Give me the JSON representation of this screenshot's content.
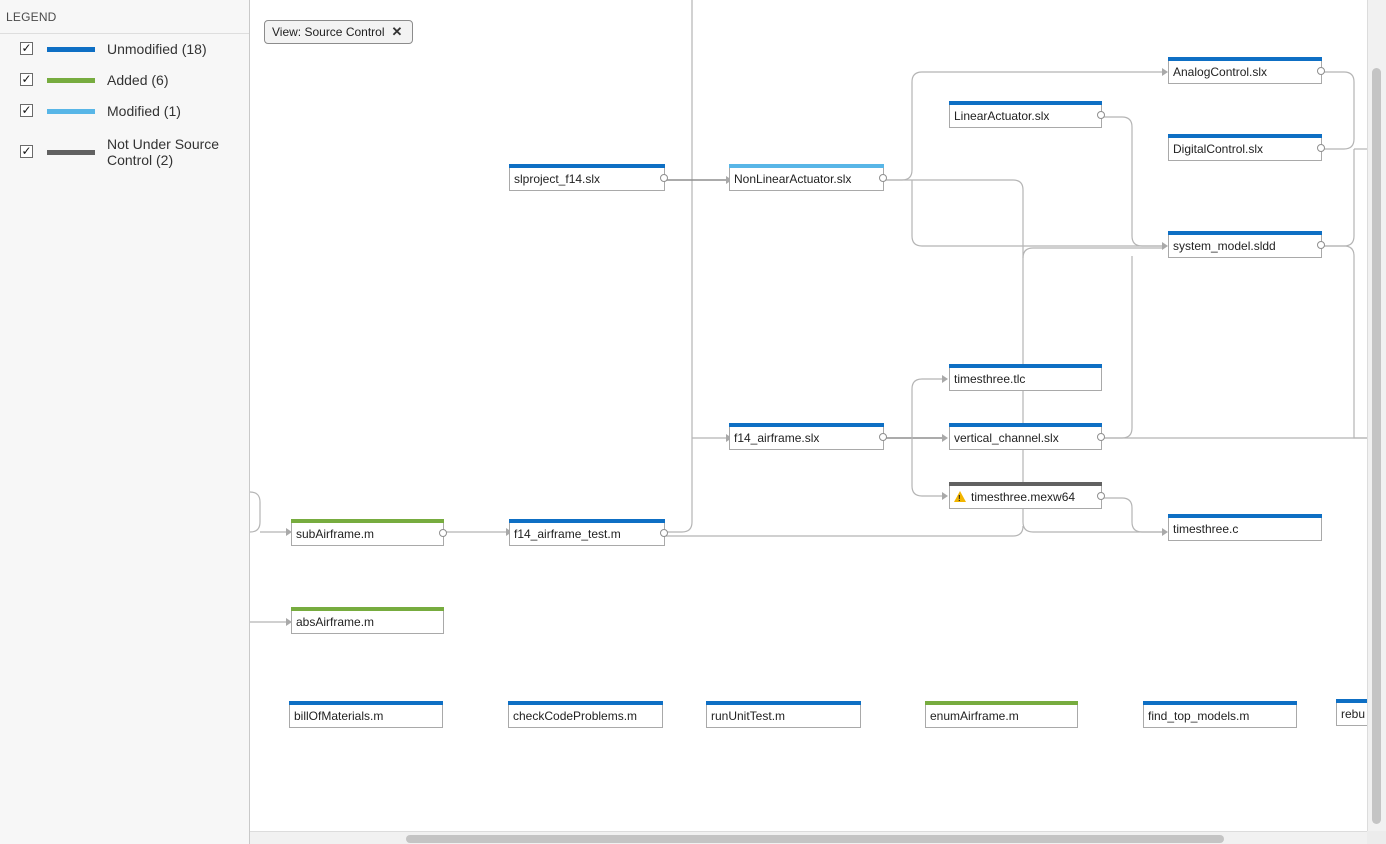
{
  "legend": {
    "title": "LEGEND",
    "items": [
      {
        "label": "Unmodified (18)",
        "color": "#0e6fc4",
        "checked": true
      },
      {
        "label": "Added (6)",
        "color": "#77ac3f",
        "checked": true
      },
      {
        "label": "Modified (1)",
        "color": "#58b6e7",
        "checked": true
      },
      {
        "label": "Not Under Source Control (2)",
        "color": "#616161",
        "checked": true
      }
    ]
  },
  "view_chip": {
    "label": "View: Source Control",
    "close_icon": "close-icon"
  },
  "nodes": {
    "slproject_f14": "slproject_f14.slx",
    "nonlinear_actuator": "NonLinearActuator.slx",
    "linear_actuator": "LinearActuator.slx",
    "analog_control": "AnalogControl.slx",
    "digital_control": "DigitalControl.slx",
    "system_model": "system_model.sldd",
    "timesthree_tlc": "timesthree.tlc",
    "vertical_channel": "vertical_channel.slx",
    "timesthree_mexw64": "timesthree.mexw64",
    "timesthree_c": "timesthree.c",
    "f14_airframe": "f14_airframe.slx",
    "sub_airframe": "subAirframe.m",
    "f14_airframe_test": "f14_airframe_test.m",
    "abs_airframe": "absAirframe.m",
    "bill_of_materials": "billOfMaterials.m",
    "check_code_problems": "checkCodeProblems.m",
    "run_unit_test": "runUnitTest.m",
    "enum_airframe": "enumAirframe.m",
    "find_top_models": "find_top_models.m",
    "rebu_partial": "rebu"
  },
  "status_colors": {
    "unmodified": "#0e6fc4",
    "added": "#77ac3f",
    "modified": "#58b6e7",
    "not_under_source_control": "#616161"
  },
  "warning_icon": "warning-icon"
}
